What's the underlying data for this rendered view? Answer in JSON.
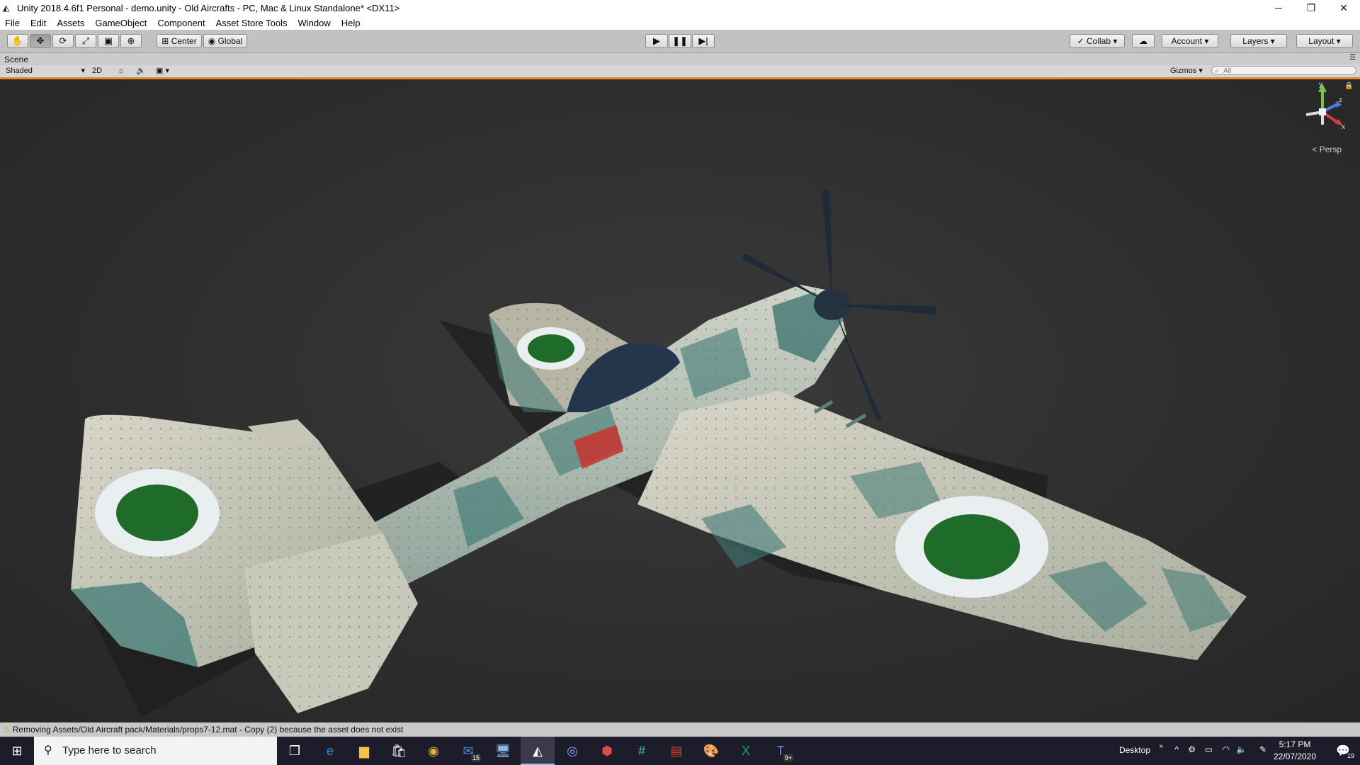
{
  "window": {
    "title": "Unity 2018.4.6f1 Personal - demo.unity - Old Aircrafts - PC, Mac & Linux Standalone* <DX11>",
    "controls": {
      "minimize": "─",
      "maximize": "❐",
      "close": "✕"
    }
  },
  "menu": [
    "File",
    "Edit",
    "Assets",
    "GameObject",
    "Component",
    "Asset Store Tools",
    "Window",
    "Help"
  ],
  "toolbar": {
    "pivot_mode": "Center",
    "pivot_rotation": "Global",
    "collab": "Collab",
    "account": "Account",
    "layers": "Layers",
    "layout": "Layout"
  },
  "scene": {
    "tab_label": "Scene",
    "shading_mode": "Shaded",
    "mode_2d": "2D",
    "gizmos": "Gizmos",
    "search_placeholder": "All",
    "persp_label": "< Persp",
    "axis_labels": {
      "y": "y",
      "z": "z",
      "x": "x"
    }
  },
  "status": {
    "message": "Removing Assets/Old Aircraft pack/Materials/props7-12.mat - Copy (2) because the asset does not exist"
  },
  "taskbar": {
    "search_placeholder": "Type here to search",
    "mail_badge": "15",
    "teams_badge": "9+",
    "desktop_label": "Desktop",
    "time": "5:17 PM",
    "date": "22/07/2020",
    "notification_count": "19"
  },
  "colors": {
    "play_accent": "#e8872c",
    "camo_light": "#c9c7b6",
    "camo_dark": "#3f7a75",
    "roundel_green": "#1f6b2a",
    "roundel_white": "#e9eef0"
  }
}
